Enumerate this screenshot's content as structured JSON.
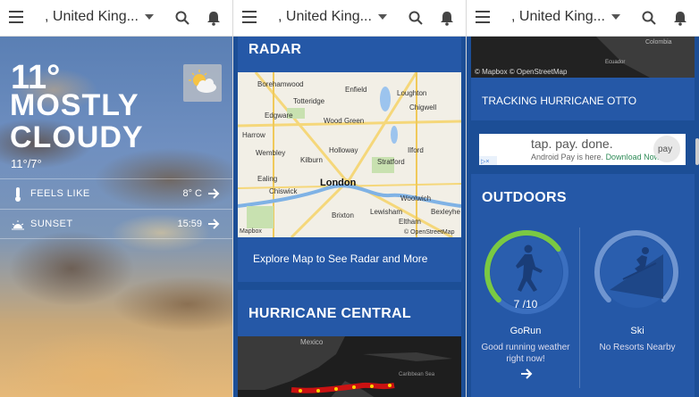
{
  "header": {
    "location": ", United King..."
  },
  "current": {
    "temperature": "11°",
    "condition": "MOSTLY CLOUDY",
    "hi_lo": "11°/7°",
    "feels_like_label": "FEELS LIKE",
    "feels_like_value": "8° C",
    "sunset_label": "SUNSET",
    "sunset_value": "15:59"
  },
  "radar": {
    "title": "RADAR",
    "cta": "Explore Map to See Radar and More",
    "map_labels": [
      "Borehamwood",
      "Enfield",
      "Loughton",
      "Totteridge",
      "Chigwell",
      "Edgware",
      "Wood Green",
      "Harrow",
      "Holloway",
      "Ilford",
      "Wembley",
      "Kilburn",
      "Stratford",
      "Ealing",
      "London",
      "Chiswick",
      "Woolwich",
      "Lewisham",
      "Bexleyhe",
      "Brixton",
      "Eltham"
    ],
    "attribution_left": "Mapbox",
    "attribution_right": "© OpenStreetMap"
  },
  "hurricane": {
    "title": "HURRICANE CENTRAL",
    "map_labels": [
      "Mexico",
      "Caribbean Sea"
    ],
    "tracking": "TRACKING HURRICANE OTTO",
    "map_labels_top": [
      "Colombia",
      "Ecuador"
    ],
    "attribution": "© Mapbox © OpenStreetMap"
  },
  "ad": {
    "headline": "tap. pay. done.",
    "sub_prefix": "Android Pay is here.",
    "sub_link": "Download Now",
    "badge": "pay"
  },
  "outdoors": {
    "title": "OUTDOORS",
    "activities": [
      {
        "name": "GoRun",
        "score": "7 /10",
        "score_value": 0.7,
        "desc": "Good running weather right now!"
      },
      {
        "name": "Ski",
        "desc": "No Resorts Nearby"
      }
    ]
  },
  "colors": {
    "card_blue": "#2558a7",
    "panel_blue": "#1c4e96",
    "gauge_green": "#7ac943"
  }
}
